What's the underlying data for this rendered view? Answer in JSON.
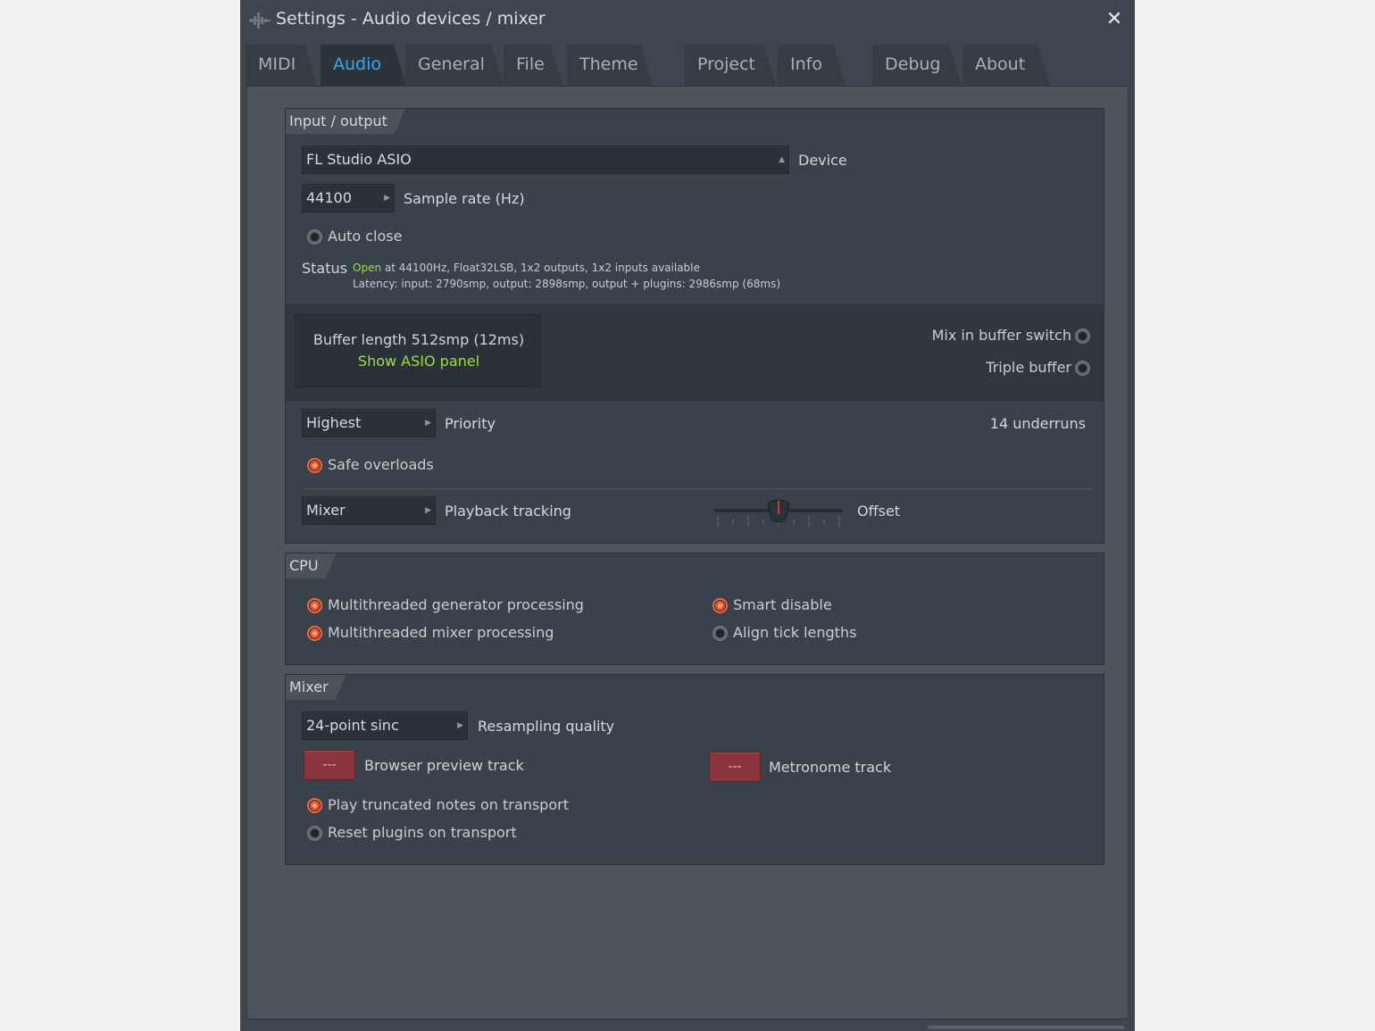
{
  "window": {
    "title": "Settings - Audio devices / mixer",
    "close_glyph": "✕"
  },
  "tabs": [
    {
      "label": "MIDI"
    },
    {
      "label": "Audio"
    },
    {
      "label": "General"
    },
    {
      "label": "File"
    },
    {
      "label": "Theme"
    },
    {
      "label": "Project"
    },
    {
      "label": "Info"
    },
    {
      "label": "Debug"
    },
    {
      "label": "About"
    }
  ],
  "active_tab": "Audio",
  "io": {
    "section_title": "Input / output",
    "device_value": "FL Studio ASIO",
    "device_label": "Device",
    "sample_rate_value": "44100",
    "sample_rate_label": "Sample rate (Hz)",
    "auto_close_label": "Auto close",
    "auto_close_checked": false,
    "status_label": "Status",
    "status_open": "Open",
    "status_line1_rest": " at 44100Hz, Float32LSB, 1x2 outputs, 1x2 inputs available",
    "status_line2": "Latency: input: 2790smp, output: 2898smp, output + plugins: 2986smp (68ms)",
    "buffer_text": "Buffer length 512smp (12ms)",
    "show_asio_panel": "Show ASIO panel",
    "mix_in_buffer_label": "Mix in buffer switch",
    "mix_in_buffer_checked": false,
    "triple_buffer_label": "Triple buffer",
    "triple_buffer_checked": false,
    "priority_value": "Highest",
    "priority_label": "Priority",
    "underruns": "14 underruns",
    "safe_overloads_label": "Safe overloads",
    "safe_overloads_checked": true,
    "tracking_value": "Mixer",
    "tracking_label": "Playback tracking",
    "offset_label": "Offset",
    "offset_value": 0.5
  },
  "cpu": {
    "section_title": "CPU",
    "options": [
      {
        "label": "Multithreaded generator processing",
        "checked": true
      },
      {
        "label": "Multithreaded mixer processing",
        "checked": true
      },
      {
        "label": "Smart disable",
        "checked": true
      },
      {
        "label": "Align tick lengths",
        "checked": false
      }
    ]
  },
  "mixer": {
    "section_title": "Mixer",
    "resampling_value": "24-point sinc",
    "resampling_label": "Resampling quality",
    "browser_preview_value": "---",
    "browser_preview_label": "Browser preview track",
    "metronome_value": "---",
    "metronome_label": "Metronome track",
    "play_truncated_label": "Play truncated notes on transport",
    "play_truncated_checked": true,
    "reset_plugins_label": "Reset plugins on transport",
    "reset_plugins_checked": false
  },
  "colors": {
    "accent_tab": "#35a9f2",
    "status_green": "#9fdc44",
    "checked_orange": "#ec6b4a",
    "track_red": "#8a343d"
  },
  "icons": {
    "title": "fl-waveform-icon",
    "close": "close-icon",
    "dropdown": "chevron-right-icon"
  }
}
